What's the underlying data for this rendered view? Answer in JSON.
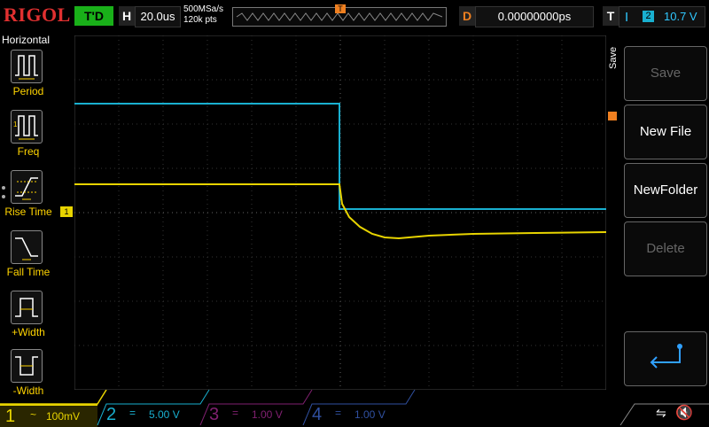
{
  "header": {
    "logo": "RIGOL",
    "run_status": "T'D",
    "horizontal_label": "H",
    "timebase": "20.0us",
    "sample_rate": "500MSa/s",
    "memory_depth": "120k pts",
    "delay_label": "D",
    "delay_value": "0.00000000ps",
    "trigger_label": "T",
    "trigger_slope": "ⵏ",
    "trigger_source": "2",
    "trigger_level": "10.7 V"
  },
  "left_menu": {
    "title": "Horizontal",
    "items": [
      {
        "label": "Period",
        "icon": "period-icon"
      },
      {
        "label": "Freq",
        "icon": "frequency-icon"
      },
      {
        "label": "Rise Time",
        "icon": "rise-time-icon"
      },
      {
        "label": "Fall Time",
        "icon": "fall-time-icon"
      },
      {
        "label": "+Width",
        "icon": "positive-width-icon"
      },
      {
        "label": "-Width",
        "icon": "negative-width-icon"
      }
    ]
  },
  "right_menu": {
    "title": "Save",
    "buttons": [
      {
        "label": "Save",
        "enabled": false
      },
      {
        "label": "New File",
        "enabled": true
      },
      {
        "label": "NewFolder",
        "enabled": true
      },
      {
        "label": "Delete",
        "enabled": false
      }
    ],
    "back_icon": "return-arrow-icon"
  },
  "channels": [
    {
      "number": "1",
      "coupling": "~",
      "scale": "100mV",
      "color": "#e8d400"
    },
    {
      "number": "2",
      "coupling": "=",
      "scale": "5.00 V",
      "color": "#19b0d0"
    },
    {
      "number": "3",
      "coupling": "=",
      "scale": "1.00 V",
      "color": "#802070"
    },
    {
      "number": "4",
      "coupling": "=",
      "scale": "1.00 V",
      "color": "#3050a0"
    }
  ],
  "ch1_marker": "1",
  "trigger_marker": "T",
  "status_icons": [
    "usb-icon",
    "speaker-muted-icon"
  ],
  "colors": {
    "ch1": "#e8d400",
    "ch2": "#19b0d0",
    "trigger": "#f08020",
    "grid": "#3a3a3a"
  }
}
